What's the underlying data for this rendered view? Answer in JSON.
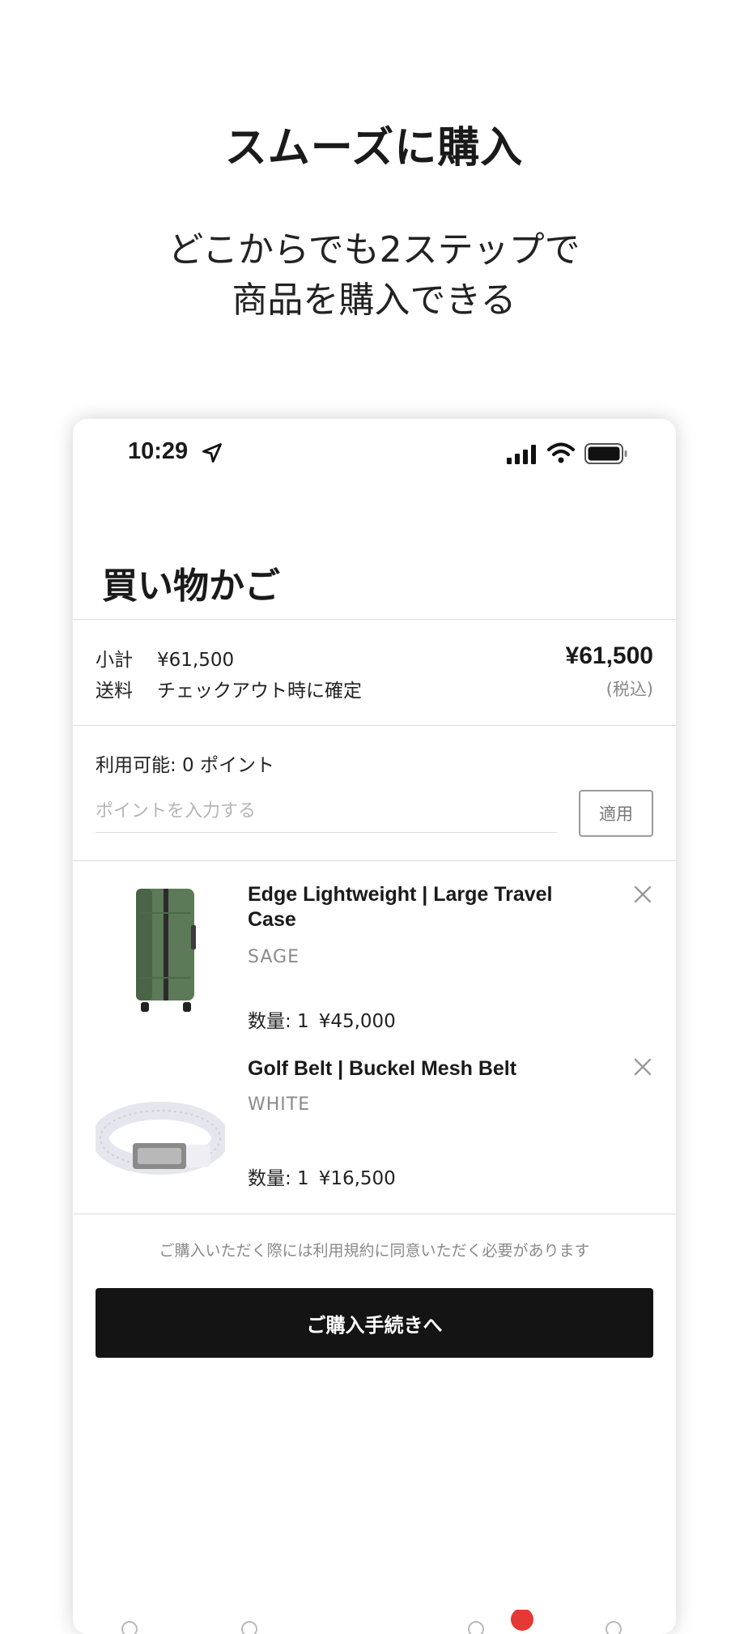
{
  "promo": {
    "title": "スムーズに購入",
    "subtitle_line1": "どこからでも2ステップで",
    "subtitle_line2": "商品を購入できる"
  },
  "status_bar": {
    "time": "10:29",
    "icons": [
      "location-arrow-icon",
      "signal-icon",
      "wifi-icon",
      "battery-icon"
    ]
  },
  "cart": {
    "title": "買い物かご",
    "summary": {
      "subtotal_label": "小計",
      "subtotal_value": "¥61,500",
      "shipping_label": "送料",
      "shipping_value": "チェックアウト時に確定",
      "total": "¥61,500",
      "tax_note": "(税込)"
    },
    "points": {
      "available_label": "利用可能: 0 ポイント",
      "input_placeholder": "ポイントを入力する",
      "input_value": "",
      "apply_label": "適用"
    },
    "items": [
      {
        "name": "Edge Lightweight | Large Travel Case",
        "color": "SAGE",
        "qty_label": "数量: 1",
        "price": "¥45,000",
        "image": "green-suitcase"
      },
      {
        "name": "Golf Belt | Buckel Mesh Belt",
        "color": "WHITE",
        "qty_label": "数量: 1",
        "price": "¥16,500",
        "image": "white-mesh-belt"
      }
    ],
    "terms_note": "ご購入いただく際には利用規約に同意いただく必要があります",
    "checkout_label": "ご購入手続きへ"
  },
  "colors": {
    "primary_button": "#141414",
    "divider": "#dcdcdc",
    "muted_text": "#8a8a8a",
    "badge": "#e53935"
  }
}
